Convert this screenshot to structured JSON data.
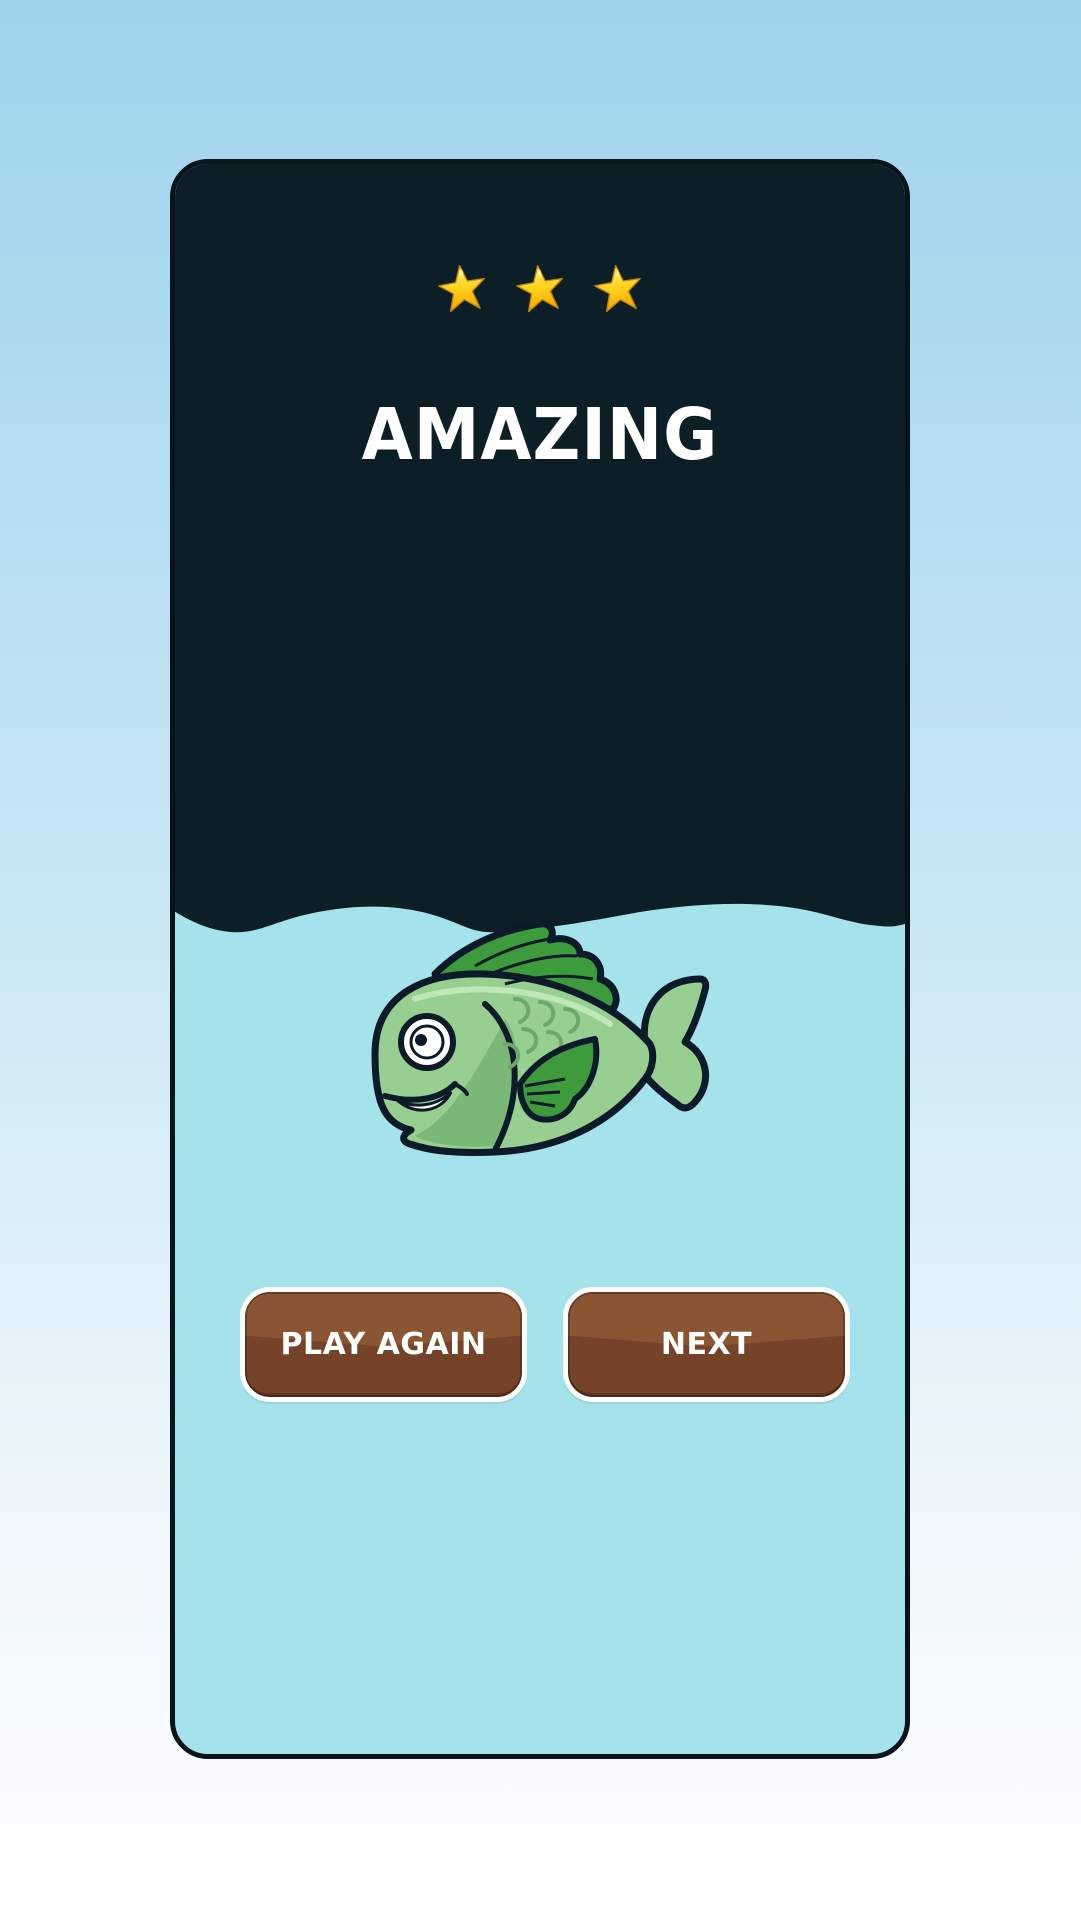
{
  "result": {
    "stars_earned": 3,
    "stars_total": 3,
    "title": "AMAZING"
  },
  "icons": {
    "star": "star-icon",
    "mascot": "fish-mascot"
  },
  "buttons": {
    "play_again": "PLAY AGAIN",
    "next": "NEXT"
  },
  "colors": {
    "panel_dark": "#0c1f27",
    "water": "#a5e3ec",
    "button_brown": "#75432a",
    "star_gold": "#ffd21c",
    "fish_green": "#96cf8f"
  }
}
